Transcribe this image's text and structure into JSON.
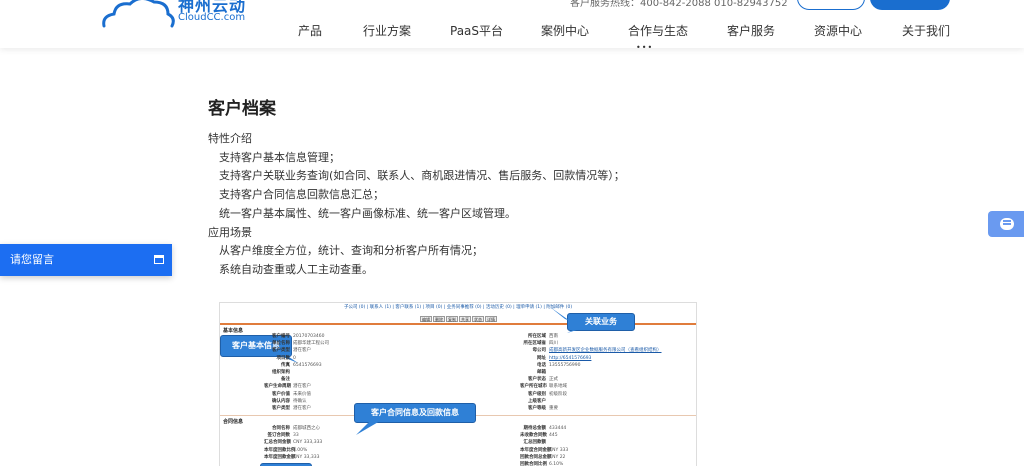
{
  "header": {
    "logo_cn": "神州云动",
    "logo_en": "CloudCC.com",
    "phone_text": "客户服务热线：400-842-2088  010-82943752",
    "nav": [
      {
        "label": "产品"
      },
      {
        "label": "行业方案"
      },
      {
        "label": "PaaS平台"
      },
      {
        "label": "案例中心"
      },
      {
        "label": "合作与生态"
      },
      {
        "label": "客户服务"
      },
      {
        "label": "资源中心"
      },
      {
        "label": "关于我们"
      }
    ],
    "nav_more": "•••"
  },
  "main": {
    "title": "客户档案",
    "sections": [
      {
        "heading": "特性介绍",
        "items": [
          "支持客户基本信息管理；",
          "支持客户关联业务查询(如合同、联系人、商机跟进情况、售后服务、回款情况等）；",
          "支持客户合同信息回款信息汇总；",
          "统一客户基本属性、统一客户画像标准、统一客户区域管理。"
        ]
      },
      {
        "heading": "应用场景",
        "items": [
          "从客户维度全方位，统计、查询和分析客户所有情况；",
          "系统自动查重或人工主动查重。"
        ]
      }
    ]
  },
  "feedback": {
    "label": "请您留言"
  },
  "screenshot": {
    "tabs": "子公司 (0) | 联系人 (1) | 客户联系 (1) | 项目 (0) | 业务同事推荐 (0) | 活动历史 (0) | 理单申请 (1) | 附加邮件 (0)",
    "buttons": [
      "编辑",
      "删除",
      "复制",
      "共享",
      "状态",
      "详情"
    ],
    "section_basic": "基本信息",
    "section_contract": "合同信息",
    "basic_left": [
      {
        "k": "客户编号",
        "v": "20170703460"
      },
      {
        "k": "单位名称",
        "v": "成都华建工程公司"
      },
      {
        "k": "客户类型",
        "v": "潜在客户"
      },
      {
        "k": "项目数",
        "v": "0"
      },
      {
        "k": "传真",
        "v": "6541576693"
      },
      {
        "k": "组织架构",
        "v": ""
      },
      {
        "k": "备注",
        "v": ""
      },
      {
        "k": "客户生命周期",
        "v": "潜在客户"
      },
      {
        "k": "客户价值",
        "v": "未来价值"
      },
      {
        "k": "确认内容",
        "v": "待确认"
      },
      {
        "k": "客户类型",
        "v": "潜在客户"
      }
    ],
    "basic_right": [
      {
        "k": "所在区域",
        "v": "西南"
      },
      {
        "k": "所在区域省",
        "v": "四川"
      },
      {
        "k": "母公司",
        "v": "成都高新开发区企业数据服务有限公司（查看组织结构）",
        "link": true
      },
      {
        "k": "网址",
        "v": "http://6541576693",
        "link": true
      },
      {
        "k": "电话",
        "v": "13555756990"
      },
      {
        "k": "邮箱",
        "v": ""
      },
      {
        "k": "客户状态",
        "v": "正式"
      },
      {
        "k": "客户所在城市",
        "v": "联系地域"
      },
      {
        "k": "客户级别",
        "v": "初级阶段"
      },
      {
        "k": "上级客户",
        "v": ""
      },
      {
        "k": "客户等级",
        "v": "重要"
      }
    ],
    "contract_left": [
      {
        "k": "合同名称",
        "v": "成都城西之心"
      },
      {
        "k": "签订合同数",
        "v": "33"
      },
      {
        "k": "汇总合同金额",
        "v": "CNY 333,333"
      },
      {
        "k": "本年度回款比例",
        "v": "1.00%"
      },
      {
        "k": "本年度回款金额",
        "v": "CNY 33,333"
      }
    ],
    "contract_right": [
      {
        "k": "期待总金额",
        "v": "433444"
      },
      {
        "k": "未收款合同数",
        "v": "445"
      },
      {
        "k": "汇总回款额",
        "v": ""
      },
      {
        "k": "本年度合同金额",
        "v": "CNY 333"
      },
      {
        "k": "回款合同总金额",
        "v": "CNY 22"
      },
      {
        "k": "回款合同比例",
        "v": "6.10%"
      }
    ],
    "callouts": {
      "related": "关联业务",
      "basic": "客户基本信息",
      "contract": "客户合同信息及回款信息"
    }
  },
  "colors": {
    "brand": "#1a6ecf",
    "feedback_bg": "#1c6ef2",
    "callout_bg": "#2f80d6",
    "accent_rule": "#e07c3c"
  }
}
